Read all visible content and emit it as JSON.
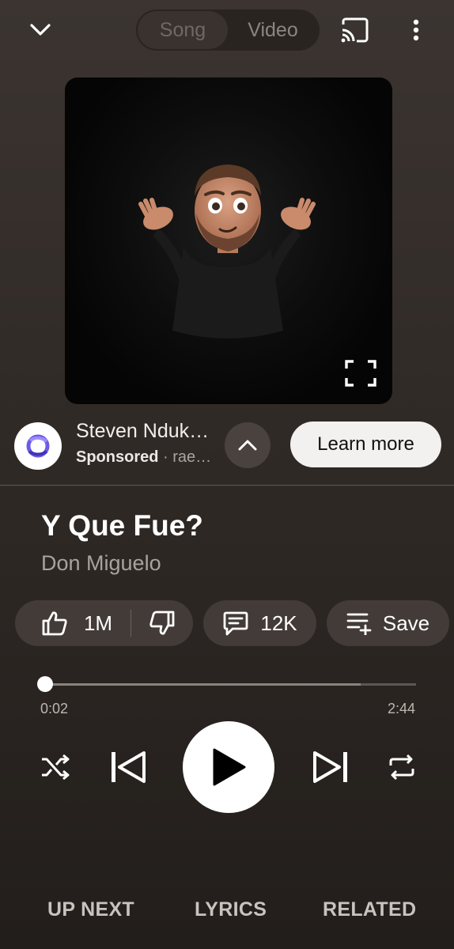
{
  "toggle": {
    "song_label": "Song",
    "video_label": "Video"
  },
  "icons": {
    "collapse": "chevron-down-icon",
    "cast": "cast-icon",
    "more": "more-vert-icon",
    "fullscreen": "fullscreen-icon",
    "ad_expand": "chevron-up-icon",
    "like": "thumb-up-icon",
    "dislike": "thumb-down-icon",
    "comments": "comment-icon",
    "save": "playlist-add-icon",
    "shuffle": "shuffle-icon",
    "previous": "skip-previous-icon",
    "play": "play-icon",
    "next": "skip-next-icon",
    "repeat": "repeat-icon"
  },
  "ad": {
    "advertiser": "Steven Nduk…",
    "sponsored_label": "Sponsored",
    "domain": "rae…",
    "cta_label": "Learn more"
  },
  "song": {
    "title": "Y Que Fue?",
    "artist": "Don Miguelo"
  },
  "actions": {
    "likes": "1M",
    "comments": "12K",
    "save_label": "Save"
  },
  "player": {
    "current_time": "0:02",
    "duration": "2:44",
    "progress_fraction": 0.0,
    "buffered_fraction": 0.85
  },
  "tabs": {
    "up_next": "UP NEXT",
    "lyrics": "LYRICS",
    "related": "RELATED"
  }
}
